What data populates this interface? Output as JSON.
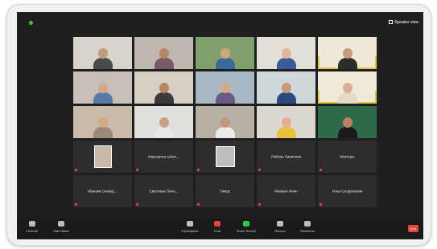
{
  "top_bar": {
    "view_label": "Speaker view"
  },
  "gallery": [
    {
      "type": "video",
      "speaking": false,
      "wall": "#d8d4cc",
      "skin": "#c49a7c",
      "shirt": "#4a4a4a",
      "name": ""
    },
    {
      "type": "video",
      "speaking": false,
      "wall": "#bfb8b0",
      "skin": "#b98464",
      "shirt": "#7a5a6a",
      "name": ""
    },
    {
      "type": "video",
      "speaking": false,
      "wall": "#7fa06a",
      "skin": "#d0a67e",
      "shirt": "#3a6a9a",
      "name": ""
    },
    {
      "type": "video",
      "speaking": false,
      "wall": "#e4e0d8",
      "skin": "#e0b898",
      "shirt": "#3a5a9a",
      "name": ""
    },
    {
      "type": "video",
      "speaking": true,
      "wall": "#efe9d8",
      "skin": "#c99a7a",
      "shirt": "#2d2d2d",
      "name": ""
    },
    {
      "type": "video",
      "speaking": false,
      "wall": "#c8c0b8",
      "skin": "#d4a888",
      "shirt": "#5a7aa8",
      "name": ""
    },
    {
      "type": "video",
      "speaking": false,
      "wall": "#d6cfc4",
      "skin": "#b8865e",
      "shirt": "#3a3a3a",
      "name": ""
    },
    {
      "type": "video",
      "speaking": false,
      "wall": "#a8b8c4",
      "skin": "#d6aa88",
      "shirt": "#6a5a8a",
      "name": ""
    },
    {
      "type": "video",
      "speaking": false,
      "wall": "#d0d8dc",
      "skin": "#c89878",
      "shirt": "#2a4a7a",
      "name": ""
    },
    {
      "type": "video",
      "speaking": true,
      "wall": "#f0ead8",
      "skin": "#d8b098",
      "shirt": "#e8d8c8",
      "name": ""
    },
    {
      "type": "video",
      "speaking": false,
      "wall": "#c8bca8",
      "skin": "#d4aa80",
      "shirt": "#9a8a7a",
      "name": ""
    },
    {
      "type": "video",
      "speaking": false,
      "wall": "#e2e0dc",
      "skin": "#c8a088",
      "shirt": "#e8e8e8",
      "name": ""
    },
    {
      "type": "video",
      "speaking": false,
      "wall": "#b8b0a4",
      "skin": "#c49878",
      "shirt": "#eaeaea",
      "name": ""
    },
    {
      "type": "video",
      "speaking": false,
      "wall": "#dcd8d0",
      "skin": "#e0b090",
      "shirt": "#e8c040",
      "name": ""
    },
    {
      "type": "video",
      "speaking": false,
      "wall": "#2e6a4a",
      "skin": "#b88060",
      "shirt": "#1a1a1a",
      "name": ""
    },
    {
      "type": "photo",
      "speaking": false,
      "name": ""
    },
    {
      "type": "name",
      "speaking": false,
      "name": "Маргарита Шпал..."
    },
    {
      "type": "photo_bw",
      "speaking": false,
      "name": ""
    },
    {
      "type": "name",
      "speaking": false,
      "name": "Любовь Кирилова"
    },
    {
      "type": "name",
      "speaking": false,
      "name": "Matvejus"
    },
    {
      "type": "name",
      "speaking": false,
      "name": "Максим Сковор..."
    },
    {
      "type": "name",
      "speaking": false,
      "name": "Светлана Пило..."
    },
    {
      "type": "name",
      "speaking": false,
      "name": "Тимур"
    },
    {
      "type": "name",
      "speaking": false,
      "name": "Михаил Илин"
    },
    {
      "type": "name",
      "speaking": false,
      "name": "Илья Скорапанов"
    }
  ],
  "toolbar": {
    "items": [
      {
        "key": "mic",
        "label": "Unmute",
        "icon": "microphone-icon",
        "color": "#bdbdbd"
      },
      {
        "key": "video",
        "label": "Start Video",
        "icon": "video-camera-icon",
        "color": "#bdbdbd"
      },
      {
        "key": "participants",
        "label": "Participants",
        "icon": "participants-icon",
        "color": "#bdbdbd"
      },
      {
        "key": "chat",
        "label": "Chat",
        "icon": "chat-icon",
        "color": "#e0463a"
      },
      {
        "key": "share",
        "label": "Share Screen",
        "icon": "share-screen-icon",
        "color": "#2ecc40"
      },
      {
        "key": "record",
        "label": "Record",
        "icon": "record-icon",
        "color": "#bdbdbd"
      },
      {
        "key": "reactions",
        "label": "Reactions",
        "icon": "reactions-icon",
        "color": "#bdbdbd"
      }
    ],
    "end_label": "End"
  },
  "colors": {
    "speaking_outline": "#e2c64a",
    "end_red": "#e0463a",
    "share_green": "#2ecc40"
  }
}
